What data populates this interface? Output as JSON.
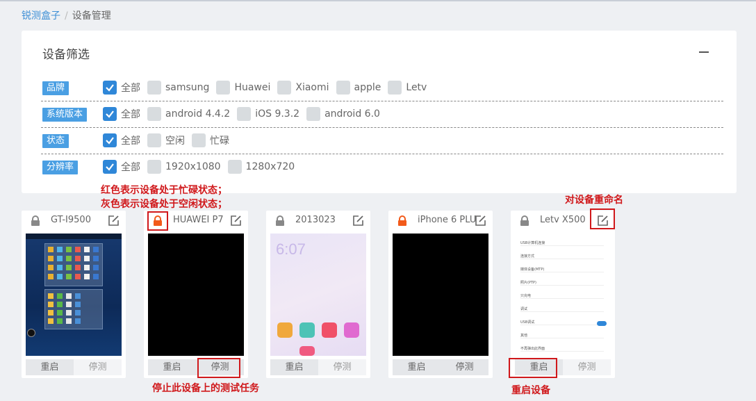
{
  "breadcrumb": {
    "root": "锐测盒子",
    "separator": "/",
    "current": "设备管理"
  },
  "filter": {
    "title": "设备筛选",
    "rows": [
      {
        "label": "品牌",
        "options": [
          {
            "text": "全部",
            "checked": true
          },
          {
            "text": "samsung",
            "checked": false
          },
          {
            "text": "Huawei",
            "checked": false
          },
          {
            "text": "Xiaomi",
            "checked": false
          },
          {
            "text": "apple",
            "checked": false
          },
          {
            "text": "Letv",
            "checked": false
          }
        ]
      },
      {
        "label": "系统版本",
        "options": [
          {
            "text": "全部",
            "checked": true
          },
          {
            "text": "android 4.4.2",
            "checked": false
          },
          {
            "text": "iOS 9.3.2",
            "checked": false
          },
          {
            "text": "android 6.0",
            "checked": false
          }
        ]
      },
      {
        "label": "状态",
        "options": [
          {
            "text": "全部",
            "checked": true
          },
          {
            "text": "空闲",
            "checked": false
          },
          {
            "text": "忙碌",
            "checked": false
          }
        ]
      },
      {
        "label": "分辨率",
        "options": [
          {
            "text": "全部",
            "checked": true
          },
          {
            "text": "1920x1080",
            "checked": false
          },
          {
            "text": "1280x720",
            "checked": false
          }
        ]
      }
    ]
  },
  "annotations": {
    "status_line1": "红色表示设备处于忙碌状态；",
    "status_line2": "灰色表示设备处于空闲状态；",
    "rename": "对设备重命名",
    "stop_task": "停止此设备上的测试任务",
    "restart": "重启设备"
  },
  "colors": {
    "busy": "#f25a1a",
    "idle": "#888888",
    "accent": "#2f87d8",
    "annotation": "#d0181b"
  },
  "devices": [
    {
      "name": "GT-I9500",
      "status": "idle",
      "restart_label": "重启",
      "stop_label": "停测"
    },
    {
      "name": "HUAWEI P7",
      "status": "busy",
      "restart_label": "重启",
      "stop_label": "停测"
    },
    {
      "name": "2013023",
      "status": "idle",
      "restart_label": "重启",
      "stop_label": "停测",
      "clock": "6:07"
    },
    {
      "name": "iPhone 6 PLUS",
      "status": "busy",
      "restart_label": "重启",
      "stop_label": "停测"
    },
    {
      "name": "Letv X500",
      "status": "idle",
      "restart_label": "重启",
      "stop_label": "停测",
      "screen_lines": [
        "USB计算机连接",
        "连接方式",
        "媒体设备(MTP)",
        "照片(PTP)",
        "只充电",
        "调试",
        "USB调试",
        "其他",
        "不再弹出此界面"
      ]
    }
  ]
}
